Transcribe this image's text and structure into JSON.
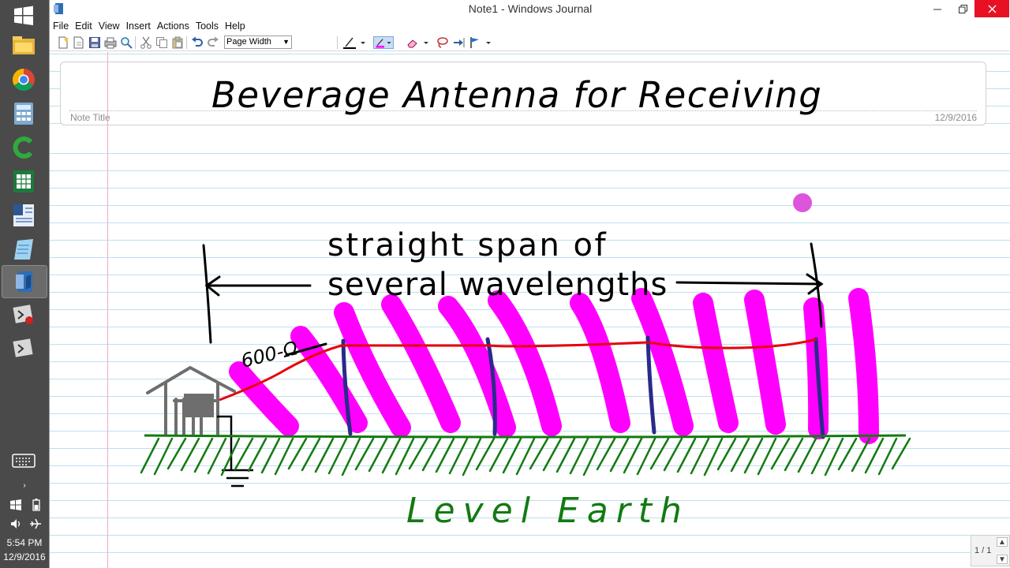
{
  "window": {
    "title": "Note1 - Windows Journal"
  },
  "menu": {
    "items": [
      "File",
      "Edit",
      "View",
      "Insert",
      "Actions",
      "Tools",
      "Help"
    ]
  },
  "toolbar": {
    "zoom_value": "Page Width"
  },
  "note": {
    "title_label": "Note Title",
    "date": "12/9/2016",
    "handwritten_title": "Beverage Antenna for Receiving",
    "annotation_line1": "straight span of",
    "annotation_line2": "several wavelengths",
    "impedance_label": "600-Ω",
    "ground_label": "Level Earth"
  },
  "pager": {
    "page_indicator": "1 / 1"
  },
  "taskbar": {
    "time": "5:54 PM",
    "date": "12/9/2016"
  },
  "colors": {
    "ink_black": "#000000",
    "ink_red": "#e8000a",
    "ink_green": "#137a12",
    "ink_magenta": "#ff00ff",
    "ink_navy": "#2a2a8a",
    "ink_gray": "#6e6e6e",
    "page_rule": "#bfe0ee",
    "page_margin": "#f2a9c2",
    "close_button": "#e81123",
    "taskbar_bg": "#4a4a4a"
  },
  "icons": [
    "windows-start-icon",
    "file-explorer-icon",
    "chrome-icon",
    "calculator-icon",
    "camtasia-icon",
    "excel-icon",
    "word-icon",
    "notepad-icon",
    "journal-icon",
    "recorder-icon",
    "recorder-icon",
    "keyboard-icon",
    "windows-logo-icon",
    "battery-icon",
    "volume-icon",
    "airplane-icon"
  ]
}
